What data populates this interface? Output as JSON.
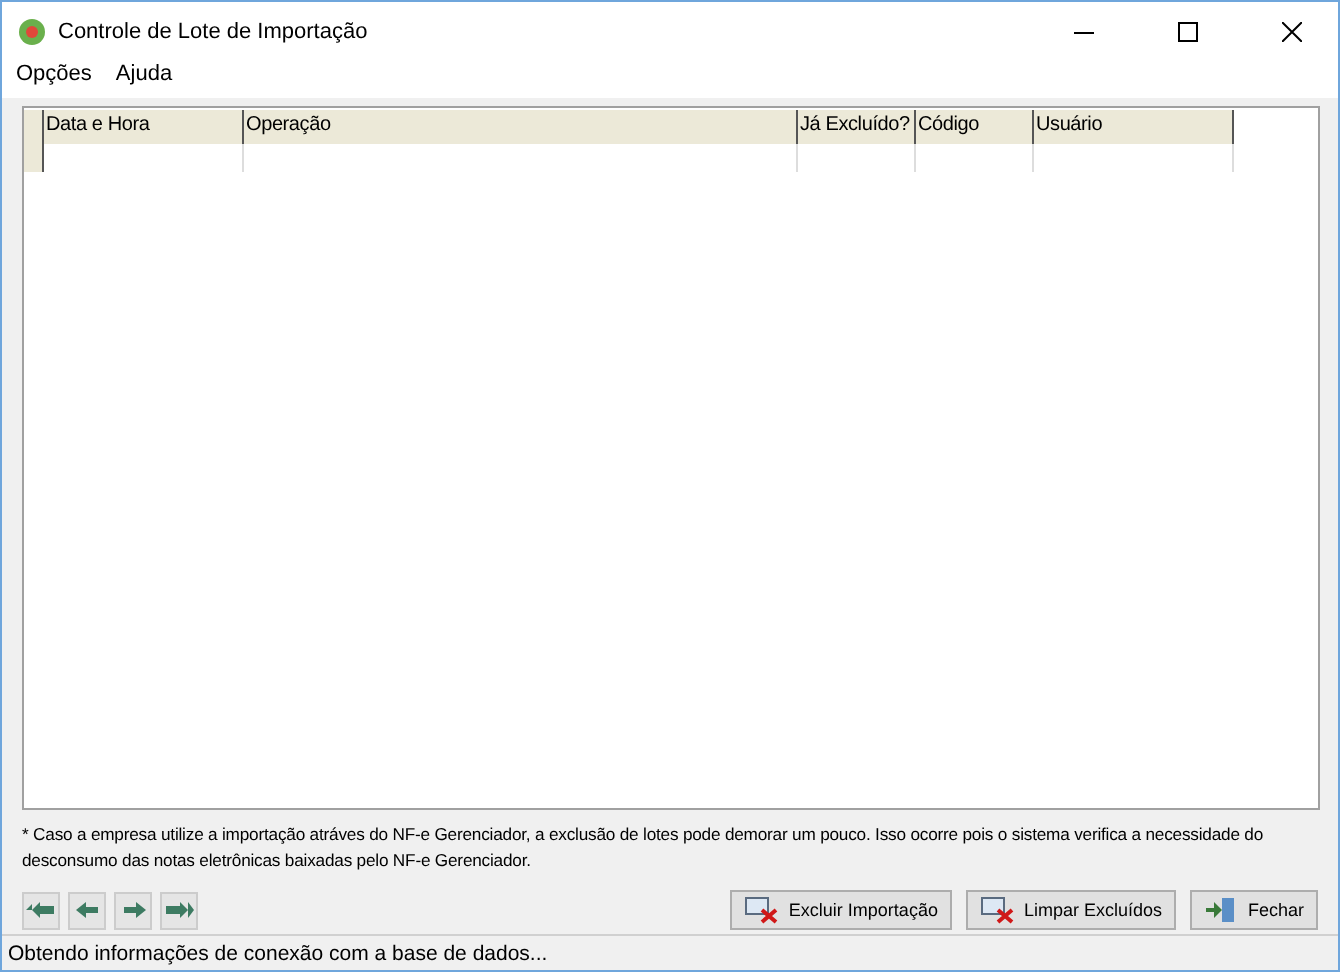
{
  "window": {
    "title": "Controle de Lote de Importação"
  },
  "menu": [
    "Opções",
    "Ajuda"
  ],
  "table": {
    "columns": [
      "Data e Hora",
      "Operação",
      "Já Excluído?",
      "Código",
      "Usuário"
    ]
  },
  "note": "* Caso a empresa utilize a importação atráves do NF-e Gerenciador, a exclusão de lotes pode demorar um pouco. Isso ocorre pois o sistema verifica a necessidade do desconsumo das notas eletrônicas baixadas pelo  NF-e Gerenciador.",
  "buttons": [
    {
      "label": "Excluir Importação",
      "kind": "delete"
    },
    {
      "label": "Limpar Excluídos",
      "kind": "delete"
    },
    {
      "label": "Fechar",
      "kind": "exit"
    }
  ],
  "status_bar": "Obtendo informações de conexão com a base de dados..."
}
